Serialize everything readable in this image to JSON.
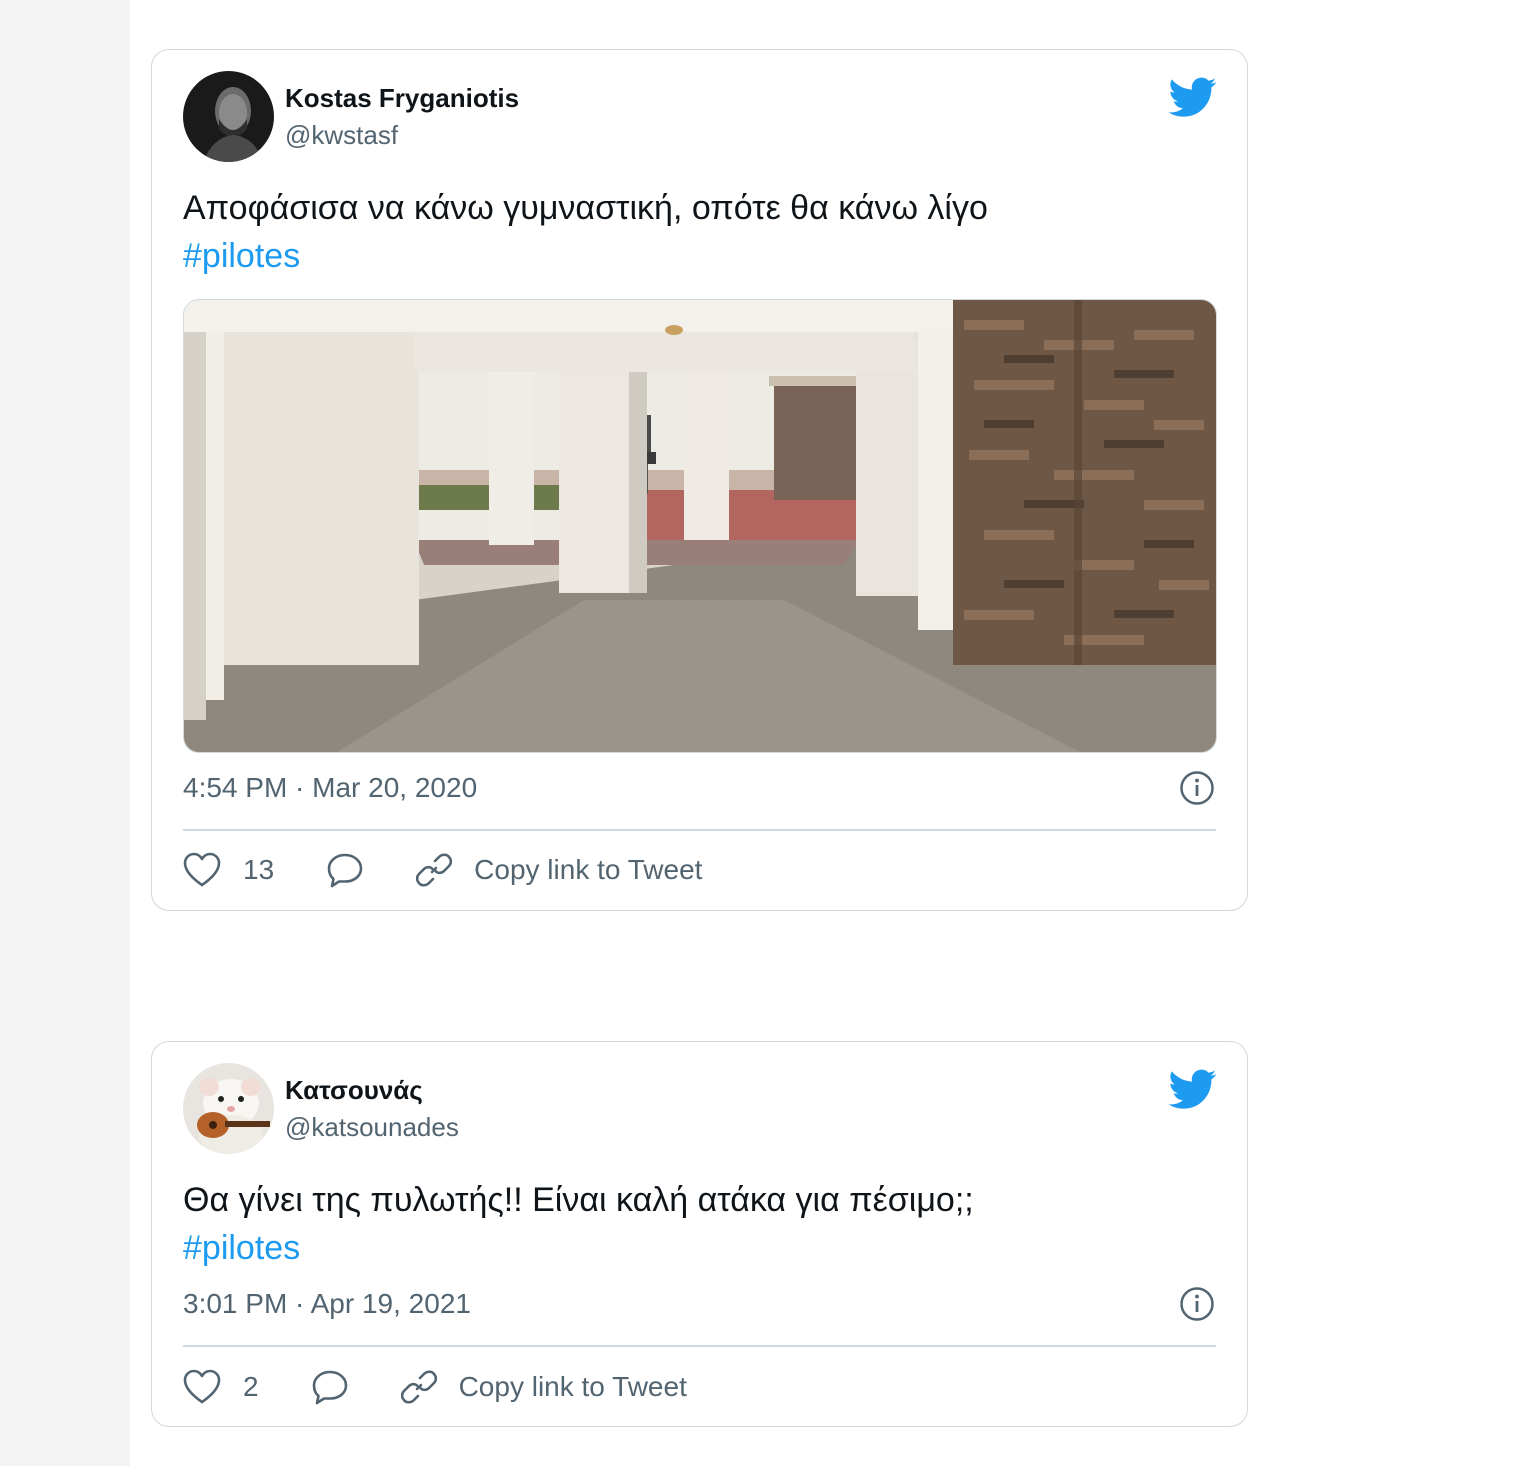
{
  "tweets": [
    {
      "display_name": "Kostas Fryganiotis",
      "handle": "@kwstasf",
      "text": "Αποφάσισα να κάνω γυμναστική, οπότε θα κάνω λίγο",
      "hashtag": "#pilotes",
      "timestamp": "4:54 PM · Mar 20, 2020",
      "likes": "13",
      "copy_link": "Copy link to Tweet",
      "avatar": "man-portrait",
      "media": "empty-pilotis-photo"
    },
    {
      "display_name": "Κατσουνάς",
      "handle": "@katsounades",
      "text": "Θα γίνει της πυλωτής!! Είναι καλή ατάκα για πέσιμο;;",
      "hashtag": "#pilotes",
      "timestamp": "3:01 PM · Apr 19, 2021",
      "likes": "2",
      "copy_link": "Copy link to Tweet",
      "avatar": "rat-with-guitar"
    }
  ],
  "colors": {
    "accent": "#1d9bf0",
    "secondary_text": "#536471",
    "border": "#cfd9de"
  },
  "icons": [
    "twitter-bird-icon",
    "info-icon",
    "heart-icon",
    "reply-icon",
    "link-icon"
  ]
}
